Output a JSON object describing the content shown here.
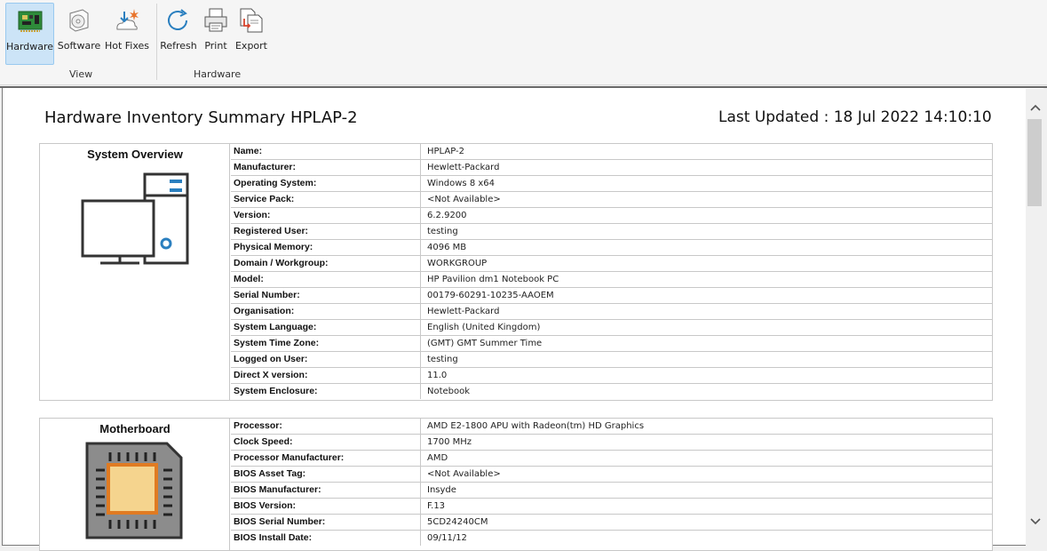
{
  "ribbon": {
    "buttons": [
      {
        "label": "Hardware",
        "icon": "circuit-board-icon",
        "active": true
      },
      {
        "label": "Software",
        "icon": "software-disc-icon"
      },
      {
        "label": "Hot Fixes",
        "icon": "hotfix-icon"
      },
      {
        "label": "Refresh",
        "icon": "refresh-icon"
      },
      {
        "label": "Print",
        "icon": "printer-icon"
      },
      {
        "label": "Export",
        "icon": "export-icon"
      }
    ],
    "groups": {
      "view": "View",
      "hardware": "Hardware"
    }
  },
  "report": {
    "title": "Hardware Inventory Summary HPLAP-2",
    "last_updated": "Last Updated : 18 Jul 2022 14:10:10"
  },
  "system_overview": {
    "title": "System Overview",
    "rows": [
      {
        "key": "Name:",
        "value": "HPLAP-2"
      },
      {
        "key": "Manufacturer:",
        "value": "Hewlett-Packard"
      },
      {
        "key": "Operating System:",
        "value": "Windows 8 x64"
      },
      {
        "key": "Service Pack:",
        "value": "<Not Available>"
      },
      {
        "key": "Version:",
        "value": "6.2.9200"
      },
      {
        "key": "Registered User:",
        "value": "testing"
      },
      {
        "key": "Physical Memory:",
        "value": "4096 MB"
      },
      {
        "key": "Domain / Workgroup:",
        "value": "WORKGROUP"
      },
      {
        "key": "Model:",
        "value": "HP Pavilion dm1 Notebook PC"
      },
      {
        "key": "Serial Number:",
        "value": "00179-60291-10235-AAOEM"
      },
      {
        "key": "Organisation:",
        "value": "Hewlett-Packard"
      },
      {
        "key": "System Language:",
        "value": "English (United Kingdom)"
      },
      {
        "key": "System Time Zone:",
        "value": "(GMT) GMT Summer Time"
      },
      {
        "key": "Logged on User:",
        "value": "testing"
      },
      {
        "key": "Direct X version:",
        "value": "11.0"
      },
      {
        "key": "System Enclosure:",
        "value": "Notebook"
      }
    ]
  },
  "motherboard": {
    "title": "Motherboard",
    "rows": [
      {
        "key": "Processor:",
        "value": "AMD E2-1800 APU with Radeon(tm) HD Graphics"
      },
      {
        "key": "Clock Speed:",
        "value": "1700 MHz"
      },
      {
        "key": "Processor Manufacturer:",
        "value": "AMD"
      },
      {
        "key": "BIOS Asset Tag:",
        "value": "<Not Available>"
      },
      {
        "key": "BIOS Manufacturer:",
        "value": "Insyde"
      },
      {
        "key": "BIOS Version:",
        "value": "F.13"
      },
      {
        "key": "BIOS Serial Number:",
        "value": "5CD24240CM"
      },
      {
        "key": "BIOS Install Date:",
        "value": "09/11/12"
      }
    ]
  },
  "colors": {
    "accent": "#2a7fbf",
    "cpu_core": "#f5d48e",
    "cpu_border": "#e07b22"
  }
}
